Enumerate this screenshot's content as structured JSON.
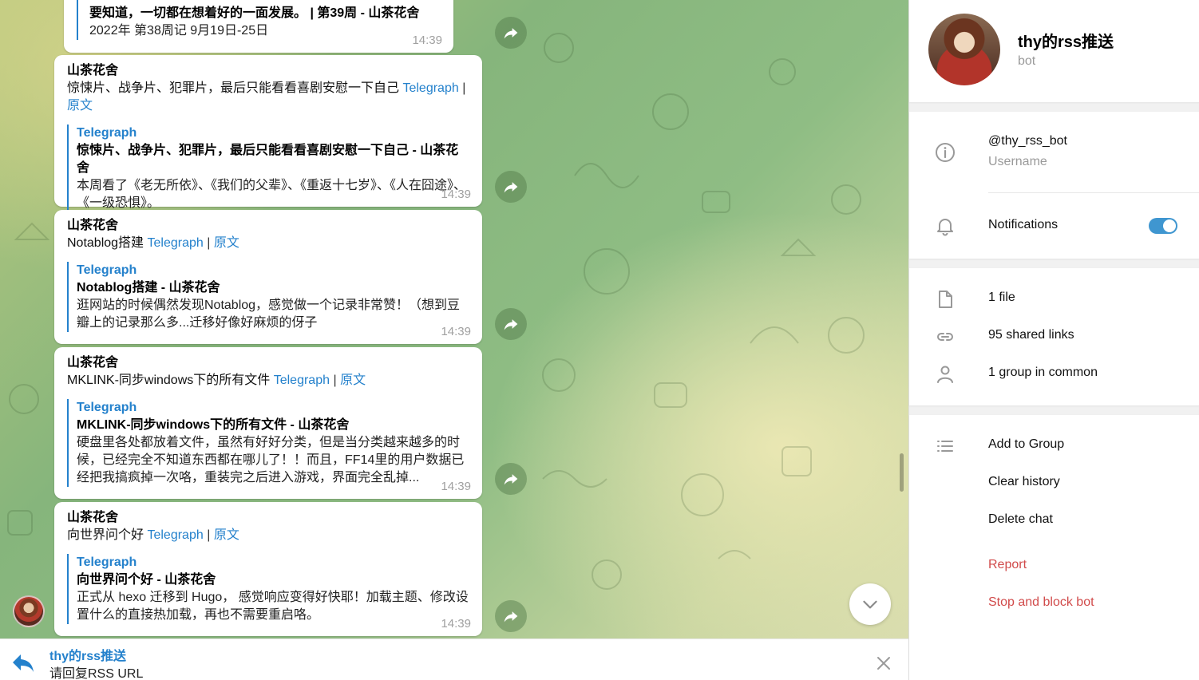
{
  "chat": {
    "messages": [
      {
        "sender": "",
        "line": "",
        "preview_title": "要知道，一切都在想着好的一面发展。 | 第39周 - 山茶花舍",
        "preview_desc": "2022年 第38周记 9月19日-25日",
        "time": "14:39"
      },
      {
        "sender": "山茶花舍",
        "line_text": "惊悚片、战争片、犯罪片，最后只能看看喜剧安慰一下自己",
        "link_telegraph": "Telegraph",
        "separator": "|",
        "link_original": "原文",
        "preview_site": "Telegraph",
        "preview_title": "惊悚片、战争片、犯罪片，最后只能看看喜剧安慰一下自己 - 山茶花舍",
        "preview_desc": "本周看了《老无所依》、《我们的父辈》、《重返十七岁》、《人在囧途》、《一级恐惧》。",
        "time": "14:39"
      },
      {
        "sender": "山茶花舍",
        "line_text": "Notablog搭建",
        "link_telegraph": "Telegraph",
        "separator": "|",
        "link_original": "原文",
        "preview_site": "Telegraph",
        "preview_title": "Notablog搭建 - 山茶花舍",
        "preview_desc": "逛网站的时候偶然发现Notablog，感觉做一个记录非常赞！（想到豆瓣上的记录那么多...迁移好像好麻烦的伢子",
        "time": "14:39"
      },
      {
        "sender": "山茶花舍",
        "line_text": "MKLINK-同步windows下的所有文件",
        "link_telegraph": "Telegraph",
        "separator": "|",
        "link_original": "原文",
        "preview_site": "Telegraph",
        "preview_title": "MKLINK-同步windows下的所有文件 - 山茶花舍",
        "preview_desc": "硬盘里各处都放着文件，虽然有好好分类，但是当分类越来越多的时候，已经完全不知道东西都在哪儿了！！而且，FF14里的用户数据已经把我搞疯掉一次咯，重装完之后进入游戏，界面完全乱掉...",
        "time": "14:39"
      },
      {
        "sender": "山茶花舍",
        "line_text": "向世界问个好",
        "link_telegraph": "Telegraph",
        "separator": "|",
        "link_original": "原文",
        "preview_site": "Telegraph",
        "preview_title": "向世界问个好 - 山茶花舍",
        "preview_desc": "正式从 hexo 迁移到 Hugo， 感觉响应变得好快耶！加载主题、修改设置什么的直接热加载，再也不需要重启咯。",
        "time": "14:39"
      }
    ]
  },
  "reply": {
    "name": "thy的rss推送",
    "text": "请回复RSS URL"
  },
  "profile": {
    "name": "thy的rss推送",
    "subtitle": "bot",
    "username": "@thy_rss_bot",
    "username_label": "Username",
    "notifications_label": "Notifications",
    "notifications_on": true,
    "files": "1 file",
    "shared_links": "95 shared links",
    "groups": "1 group in common",
    "actions": {
      "add_to_group": "Add to Group",
      "clear_history": "Clear history",
      "delete_chat": "Delete chat",
      "report": "Report",
      "stop_block": "Stop and block bot"
    }
  },
  "colors": {
    "accent": "#2481cc",
    "danger": "#d14b4b",
    "toggle": "#3f96d0"
  }
}
